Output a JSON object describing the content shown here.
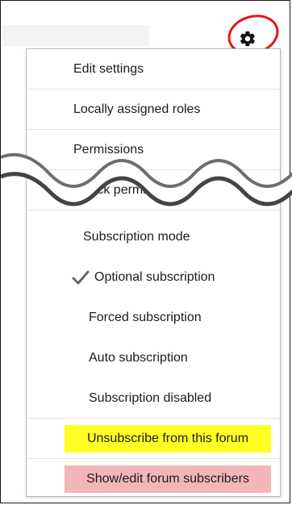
{
  "header": {
    "gear_icon": "gear-icon"
  },
  "menu": {
    "items": [
      {
        "label": "Edit settings"
      },
      {
        "label": "Locally assigned roles"
      },
      {
        "label": "Permissions"
      },
      {
        "label": "Check permissions"
      },
      {
        "label": "Subscription mode"
      },
      {
        "label": "Optional subscription",
        "selected": true
      },
      {
        "label": "Forced subscription"
      },
      {
        "label": "Auto subscription"
      },
      {
        "label": "Subscription disabled"
      },
      {
        "label": "Unsubscribe from this forum",
        "highlight": "#ffff24"
      },
      {
        "label": "Show/edit forum subscribers",
        "highlight": "#f3b6b8"
      }
    ]
  },
  "colors": {
    "annotation_circle": "#e01818",
    "checkmark": "#666666"
  }
}
